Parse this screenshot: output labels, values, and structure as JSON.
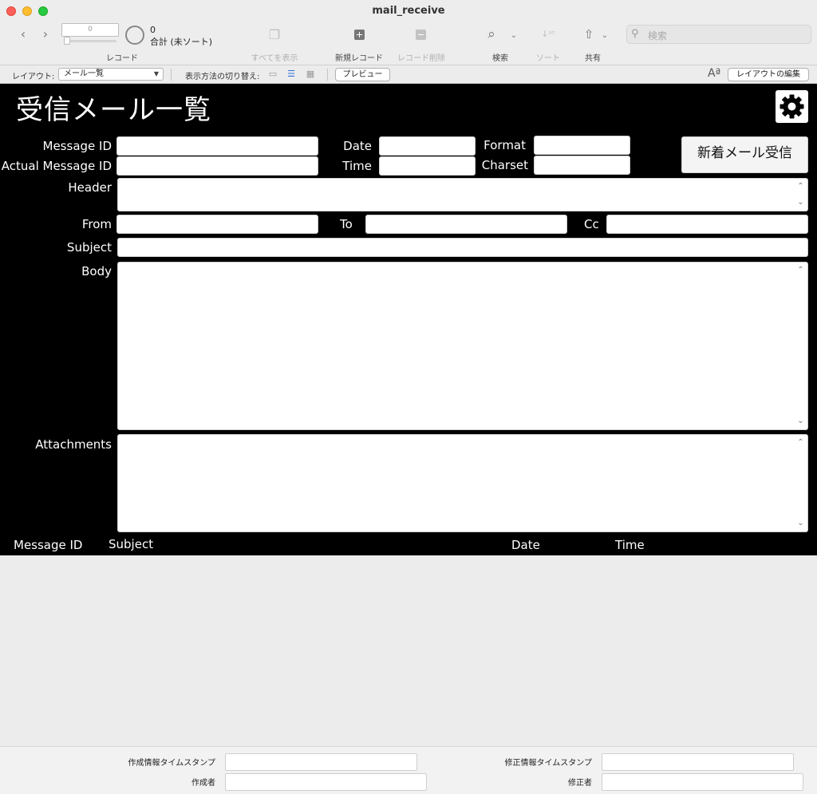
{
  "window": {
    "title": "mail_receive"
  },
  "toolbar": {
    "record_field_value": "0",
    "record_count": "0",
    "sort_state": "合計 (未ソート)",
    "record_label": "レコード",
    "show_all_label": "すべてを表示",
    "new_record_label": "新規レコード",
    "delete_record_label": "レコード削除",
    "find_label": "検索",
    "sort_label": "ソート",
    "share_label": "共有",
    "search_placeholder": "検索"
  },
  "layout_bar": {
    "layout_label": "レイアウト:",
    "layout_value": "メール一覧",
    "view_switch_label": "表示方法の切り替え:",
    "preview_label": "プレビュー",
    "font_size_glyph": "Aª",
    "edit_layout_label": "レイアウトの編集"
  },
  "form": {
    "title": "受信メール一覧",
    "new_mail_button": "新着メール受信",
    "labels": {
      "message_id": "Message ID",
      "actual_message_id": "Actual Message ID",
      "date": "Date",
      "time": "Time",
      "format": "Format",
      "charset": "Charset",
      "header": "Header",
      "from": "From",
      "to": "To",
      "cc": "Cc",
      "subject": "Subject",
      "body": "Body",
      "attachments": "Attachments"
    },
    "values": {
      "message_id": "",
      "actual_message_id": "",
      "date": "",
      "time": "",
      "format": "",
      "charset": "",
      "header": "",
      "from": "",
      "to": "",
      "cc": "",
      "subject": "",
      "body": "",
      "attachments": ""
    }
  },
  "list_header": {
    "message_id": "Message ID",
    "subject": "Subject",
    "date": "Date",
    "time": "Time"
  },
  "footer": {
    "created_ts_label": "作成情報タイムスタンプ",
    "creator_label": "作成者",
    "modified_ts_label": "修正情報タイムスタンプ",
    "modifier_label": "修正者"
  },
  "icons": {
    "back": "chevron-left-icon",
    "forward": "chevron-right-icon",
    "settings": "gear-icon",
    "search": "magnifier-icon"
  }
}
